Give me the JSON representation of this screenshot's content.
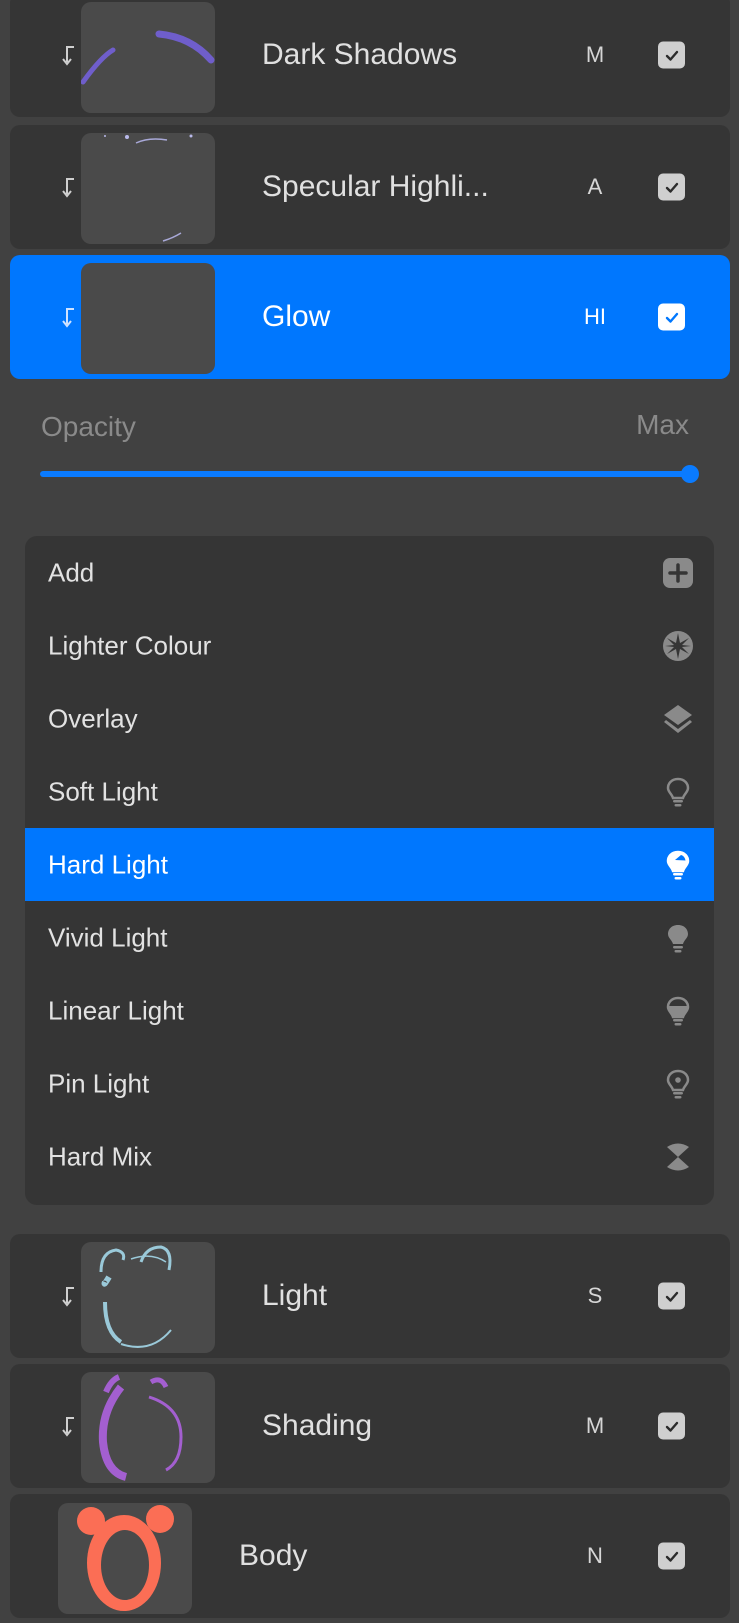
{
  "colors": {
    "accent": "#0077fe",
    "background": "#414141",
    "row_background": "#353535",
    "thumbnail_background": "#4a4a4a",
    "icon_gray": "#8a8a8a"
  },
  "layers_above": [
    {
      "name": "Dark Shadows",
      "blend_code": "M",
      "visible": true,
      "clipping_mask": true,
      "selected": false,
      "thumbnail": "purple-arc-strokes"
    },
    {
      "name": "Specular Highli...",
      "blend_code": "A",
      "visible": true,
      "clipping_mask": true,
      "selected": false,
      "thumbnail": "faint-highlight-specks"
    },
    {
      "name": "Glow",
      "blend_code": "HI",
      "visible": true,
      "clipping_mask": true,
      "selected": true,
      "thumbnail": "empty"
    }
  ],
  "opacity": {
    "label": "Opacity",
    "value_label": "Max",
    "value_fraction": 1.0
  },
  "blend_modes": [
    {
      "label": "Add",
      "icon": "plus-square-icon",
      "selected": false
    },
    {
      "label": "Lighter Colour",
      "icon": "starburst-icon",
      "selected": false
    },
    {
      "label": "Overlay",
      "icon": "layers-icon",
      "selected": false
    },
    {
      "label": "Soft Light",
      "icon": "lightbulb-outline-icon",
      "selected": false
    },
    {
      "label": "Hard Light",
      "icon": "lightbulb-half-icon",
      "selected": true
    },
    {
      "label": "Vivid Light",
      "icon": "lightbulb-filled-icon",
      "selected": false
    },
    {
      "label": "Linear Light",
      "icon": "lightbulb-bottom-filled-icon",
      "selected": false
    },
    {
      "label": "Pin Light",
      "icon": "lightbulb-dot-icon",
      "selected": false
    },
    {
      "label": "Hard Mix",
      "icon": "hourglass-icon",
      "selected": false
    }
  ],
  "layers_below": [
    {
      "name": "Light",
      "blend_code": "S",
      "visible": true,
      "clipping_mask": true,
      "selected": false,
      "thumbnail": "blue-alarm-clock-outline"
    },
    {
      "name": "Shading",
      "blend_code": "M",
      "visible": true,
      "clipping_mask": true,
      "selected": false,
      "thumbnail": "purple-alarm-clock-outline"
    },
    {
      "name": "Body",
      "blend_code": "N",
      "visible": true,
      "clipping_mask": false,
      "selected": false,
      "thumbnail": "orange-alarm-clock"
    }
  ]
}
